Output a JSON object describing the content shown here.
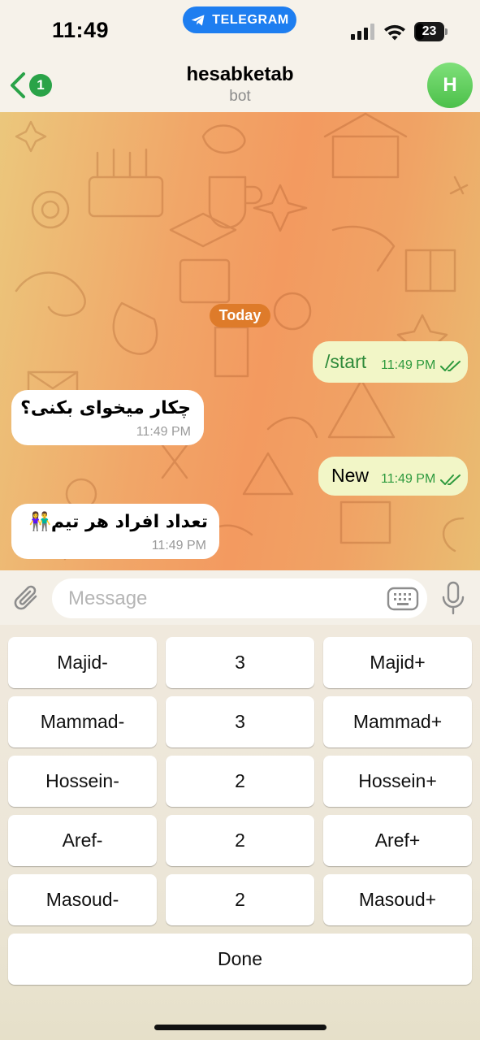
{
  "status_bar": {
    "time": "11:49",
    "app_pill": "TELEGRAM",
    "battery": "23"
  },
  "header": {
    "back_count": "1",
    "title": "hesabketab",
    "subtitle": "bot",
    "avatar_letter": "H"
  },
  "chat": {
    "date_chip": "Today",
    "messages": [
      {
        "direction": "out",
        "text": "/start",
        "time": "11:49 PM"
      },
      {
        "direction": "in",
        "text": "چکار میخوای بکنی؟",
        "time": "11:49 PM"
      },
      {
        "direction": "out",
        "text": "New",
        "time": "11:49 PM"
      },
      {
        "direction": "in",
        "text": "تعداد افراد هر تیم👫",
        "time": "11:49 PM"
      }
    ]
  },
  "input": {
    "placeholder": "Message"
  },
  "keyboard": {
    "rows": [
      [
        "Majid-",
        "3",
        "Majid+"
      ],
      [
        "Mammad-",
        "3",
        "Mammad+"
      ],
      [
        "Hossein-",
        "2",
        "Hossein+"
      ],
      [
        "Aref-",
        "2",
        "Aref+"
      ],
      [
        "Masoud-",
        "2",
        "Masoud+"
      ]
    ],
    "done": "Done"
  },
  "colors": {
    "telegram_blue": "#1e7ef0",
    "outgoing_bubble": "#f2f6c7",
    "outgoing_meta": "#2e9a3e",
    "date_chip": "#de7b2a",
    "avatar": "#4cc04a"
  }
}
